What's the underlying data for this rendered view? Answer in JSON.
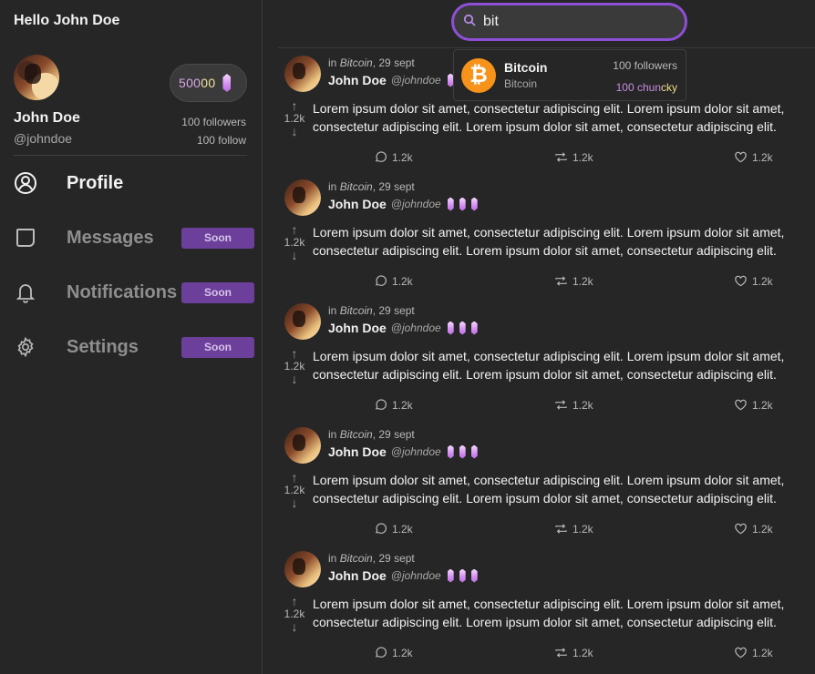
{
  "sidebar": {
    "greeting": "Hello John Doe",
    "balance": {
      "main": "500",
      "tail": "00"
    },
    "user": {
      "name": "John Doe",
      "handle": "@johndoe",
      "followers": "100 followers",
      "follow": "100 follow"
    },
    "nav": [
      {
        "label": "Profile",
        "icon": "user-circle-icon",
        "active": true
      },
      {
        "label": "Messages",
        "icon": "message-square-icon",
        "badge": "Soon"
      },
      {
        "label": "Notifications",
        "icon": "bell-icon",
        "badge": "Soon"
      },
      {
        "label": "Settings",
        "icon": "gear-icon",
        "badge": "Soon"
      }
    ]
  },
  "search": {
    "value": "bit",
    "icon": "search-icon"
  },
  "dropdown": {
    "title": "Bitcoin",
    "subtitle": "Bitcoin",
    "followers": "100 followers",
    "chuncky": {
      "main": "100 chun",
      "tail": "cky"
    },
    "logo_glyph": "₿"
  },
  "posts": [
    {
      "meta_prefix": "in ",
      "community": "Bitcoin",
      "date": ", 29 sept",
      "name": "John Doe",
      "handle": "@johndoe",
      "votes": "1.2k",
      "body": "Lorem ipsum dolor sit amet, consectetur adipiscing elit. Lorem ipsum dolor sit amet, consectetur adipiscing elit. Lorem ipsum dolor sit amet, consectetur adipiscing elit.",
      "comments": "1.2k",
      "reposts": "1.2k",
      "likes": "1.2k"
    },
    {
      "meta_prefix": "in ",
      "community": "Bitcoin",
      "date": ", 29 sept",
      "name": "John Doe",
      "handle": "@johndoe",
      "votes": "1.2k",
      "body": "Lorem ipsum dolor sit amet, consectetur adipiscing elit. Lorem ipsum dolor sit amet, consectetur adipiscing elit. Lorem ipsum dolor sit amet, consectetur adipiscing elit.",
      "comments": "1.2k",
      "reposts": "1.2k",
      "likes": "1.2k"
    },
    {
      "meta_prefix": "in ",
      "community": "Bitcoin",
      "date": ", 29 sept",
      "name": "John Doe",
      "handle": "@johndoe",
      "votes": "1.2k",
      "body": "Lorem ipsum dolor sit amet, consectetur adipiscing elit. Lorem ipsum dolor sit amet, consectetur adipiscing elit. Lorem ipsum dolor sit amet, consectetur adipiscing elit.",
      "comments": "1.2k",
      "reposts": "1.2k",
      "likes": "1.2k"
    },
    {
      "meta_prefix": "in ",
      "community": "Bitcoin",
      "date": ", 29 sept",
      "name": "John Doe",
      "handle": "@johndoe",
      "votes": "1.2k",
      "body": "Lorem ipsum dolor sit amet, consectetur adipiscing elit. Lorem ipsum dolor sit amet, consectetur adipiscing elit. Lorem ipsum dolor sit amet, consectetur adipiscing elit.",
      "comments": "1.2k",
      "reposts": "1.2k",
      "likes": "1.2k"
    },
    {
      "meta_prefix": "in ",
      "community": "Bitcoin",
      "date": ", 29 sept",
      "name": "John Doe",
      "handle": "@johndoe",
      "votes": "1.2k",
      "body": "Lorem ipsum dolor sit amet, consectetur adipiscing elit. Lorem ipsum dolor sit amet, consectetur adipiscing elit. Lorem ipsum dolor sit amet, consectetur adipiscing elit.",
      "comments": "1.2k",
      "reposts": "1.2k",
      "likes": "1.2k"
    }
  ],
  "colors": {
    "accent": "#8e4fd6",
    "soon_badge": "#6b3f9a",
    "bitcoin": "#f7931a",
    "background": "#262626"
  }
}
